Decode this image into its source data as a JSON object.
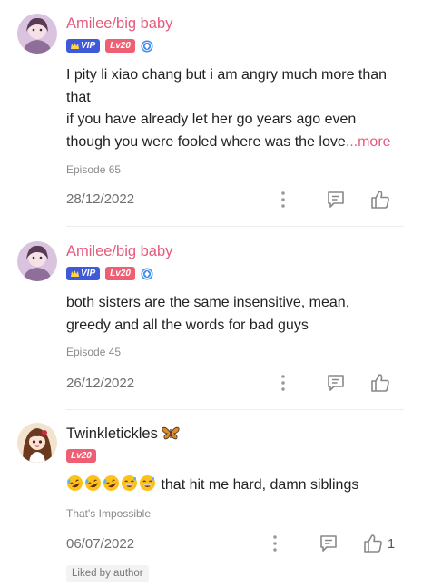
{
  "comments": [
    {
      "username": "Amilee/big baby",
      "vip_label": "VIP",
      "level_label": "Lv20",
      "text_lines": [
        "I pity li xiao chang but i am angry much more than",
        "that",
        "if you have already let her go years ago even",
        "though you were fooled where was the love"
      ],
      "more_label": "...more",
      "episode": "Episode 65",
      "date": "28/12/2022"
    },
    {
      "username": "Amilee/big baby",
      "vip_label": "VIP",
      "level_label": "Lv20",
      "text_lines": [
        "both sisters are the same insensitive, mean,",
        "greedy and all the words for bad guys"
      ],
      "episode": "Episode 45",
      "date": "26/12/2022"
    },
    {
      "username": "Twinkletickles",
      "level_label": "Lv20",
      "text": "that hit me hard, damn siblings",
      "episode": "That's Impossible",
      "date": "06/07/2022",
      "like_count": "1",
      "liked_badge": "Liked by author"
    }
  ],
  "icons": {
    "vip": "crown-icon",
    "verified": "diamond-badge-icon",
    "more": "vertical-dots-icon",
    "reply": "comment-bubble-icon",
    "like": "thumbs-up-icon",
    "name_decoration": "butterfly-icon",
    "emojis": [
      "rofl-emoji",
      "rofl-emoji",
      "rofl-emoji",
      "grinning-sweat-emoji",
      "grinning-sweat-emoji"
    ]
  },
  "colors": {
    "username": "#e65a7b",
    "vip_badge": "#3f5ad8",
    "level_badge": "#ee5f73",
    "more_link": "#e65a7b"
  }
}
